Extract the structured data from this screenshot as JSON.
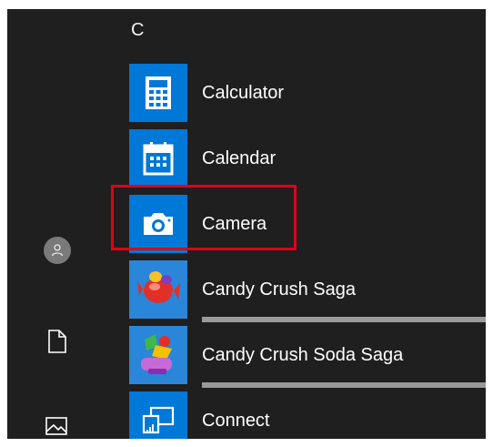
{
  "start_menu": {
    "section_letter": "C",
    "apps": [
      {
        "label": "Calculator",
        "icon": "calculator-icon"
      },
      {
        "label": "Calendar",
        "icon": "calendar-icon"
      },
      {
        "label": "Camera",
        "icon": "camera-icon"
      },
      {
        "label": "Candy Crush Saga",
        "icon": "candy-crush-saga-icon",
        "install_progress": 1.0
      },
      {
        "label": "Candy Crush Soda Saga",
        "icon": "candy-crush-soda-saga-icon",
        "install_progress": 1.0
      },
      {
        "label": "Connect",
        "icon": "connect-icon"
      }
    ],
    "rail_icons": [
      "user-avatar-icon",
      "document-icon",
      "pictures-icon"
    ]
  },
  "colors": {
    "menu_background": "#1f1f1f",
    "tile_blue": "#0078d7",
    "highlight_red": "#e0001a"
  }
}
